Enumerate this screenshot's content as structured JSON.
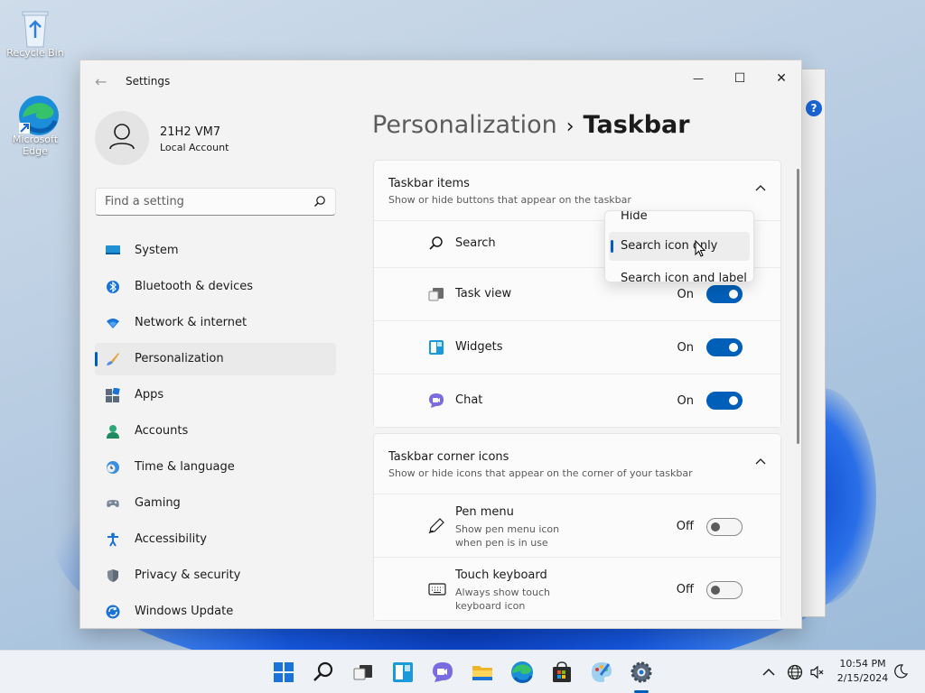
{
  "desktop": {
    "icons": [
      {
        "label": "Recycle Bin"
      },
      {
        "label": "Microsoft Edge"
      }
    ]
  },
  "window": {
    "title": "Settings",
    "controls": {
      "minimize": "—",
      "maximize": "☐",
      "close": "✕"
    }
  },
  "profile": {
    "name": "21H2 VM7",
    "account_type": "Local Account"
  },
  "search": {
    "placeholder": "Find a setting"
  },
  "sidebar": {
    "items": [
      {
        "label": "System",
        "icon": "system-icon"
      },
      {
        "label": "Bluetooth & devices",
        "icon": "bluetooth-icon"
      },
      {
        "label": "Network & internet",
        "icon": "wifi-icon"
      },
      {
        "label": "Personalization",
        "icon": "brush-icon",
        "active": true
      },
      {
        "label": "Apps",
        "icon": "apps-icon"
      },
      {
        "label": "Accounts",
        "icon": "accounts-icon"
      },
      {
        "label": "Time & language",
        "icon": "clock-globe-icon"
      },
      {
        "label": "Gaming",
        "icon": "gamepad-icon"
      },
      {
        "label": "Accessibility",
        "icon": "accessibility-icon"
      },
      {
        "label": "Privacy & security",
        "icon": "shield-icon"
      },
      {
        "label": "Windows Update",
        "icon": "update-icon"
      }
    ]
  },
  "breadcrumb": {
    "parent": "Personalization",
    "separator": "›",
    "current": "Taskbar"
  },
  "taskbar_items": {
    "title": "Taskbar items",
    "subtitle": "Show or hide buttons that appear on the taskbar",
    "rows": [
      {
        "label": "Search",
        "icon": "search-icon"
      },
      {
        "label": "Task view",
        "icon": "task-view-icon",
        "state": "On"
      },
      {
        "label": "Widgets",
        "icon": "widgets-icon",
        "state": "On"
      },
      {
        "label": "Chat",
        "icon": "chat-icon",
        "state": "On"
      }
    ]
  },
  "search_dropdown": {
    "options": [
      "Hide",
      "Search icon only",
      "Search icon and label"
    ],
    "selected": "Search icon only"
  },
  "corner_icons": {
    "title": "Taskbar corner icons",
    "subtitle": "Show or hide icons that appear on the corner of your taskbar",
    "rows": [
      {
        "label": "Pen menu",
        "desc": "Show pen menu icon when pen is in use",
        "state": "Off",
        "icon": "pen-icon"
      },
      {
        "label": "Touch keyboard",
        "desc": "Always show touch keyboard icon",
        "state": "Off",
        "icon": "keyboard-icon"
      }
    ]
  },
  "tray": {
    "time": "10:54 PM",
    "date": "2/15/2024"
  },
  "colors": {
    "accent": "#005fb8",
    "window_bg": "#f3f3f3",
    "card_bg": "#fbfbfb"
  }
}
